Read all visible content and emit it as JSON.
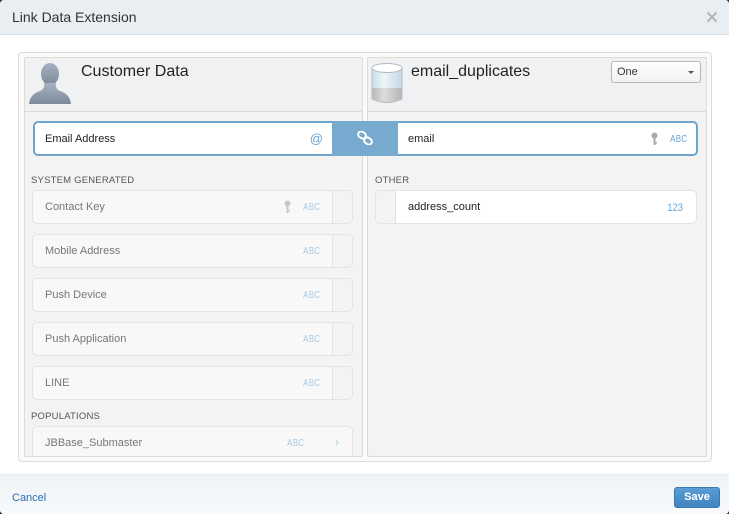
{
  "dialog": {
    "title": "Link Data Extension",
    "close_icon": "close-icon"
  },
  "left_panel": {
    "title": "Customer Data",
    "icon": "person-silhouette-icon",
    "linked_field": {
      "label": "Email Address",
      "type_icon": "@"
    },
    "sections": [
      {
        "label": "SYSTEM GENERATED",
        "fields": [
          {
            "name": "Contact Key",
            "type": "ABC",
            "is_key": true
          },
          {
            "name": "Mobile Address",
            "type": "ABC",
            "is_key": false
          },
          {
            "name": "Push Device",
            "type": "ABC",
            "is_key": false
          },
          {
            "name": "Push Application",
            "type": "ABC",
            "is_key": false
          },
          {
            "name": "LINE",
            "type": "ABC",
            "is_key": false
          }
        ]
      },
      {
        "label": "POPULATIONS",
        "fields": [
          {
            "name": "JBBase_Submaster",
            "type": "ABC",
            "chevron": "›"
          }
        ]
      }
    ]
  },
  "right_panel": {
    "title": "email_duplicates",
    "icon": "database-icon",
    "relationship_select": {
      "value": "One"
    },
    "linked_field": {
      "label": "email",
      "type": "ABC",
      "is_key": true
    },
    "sections": [
      {
        "label": "OTHER",
        "fields": [
          {
            "name": "address_count",
            "type": "123"
          }
        ]
      }
    ]
  },
  "link_connector": {
    "icon": "link-chain-icon"
  },
  "footer": {
    "cancel_label": "Cancel",
    "save_label": "Save"
  },
  "colors": {
    "accent": "#78a9cf",
    "link_border": "#6fa6ce",
    "save_button": "#4a8ec9",
    "cancel_link": "#2a6fb0"
  }
}
